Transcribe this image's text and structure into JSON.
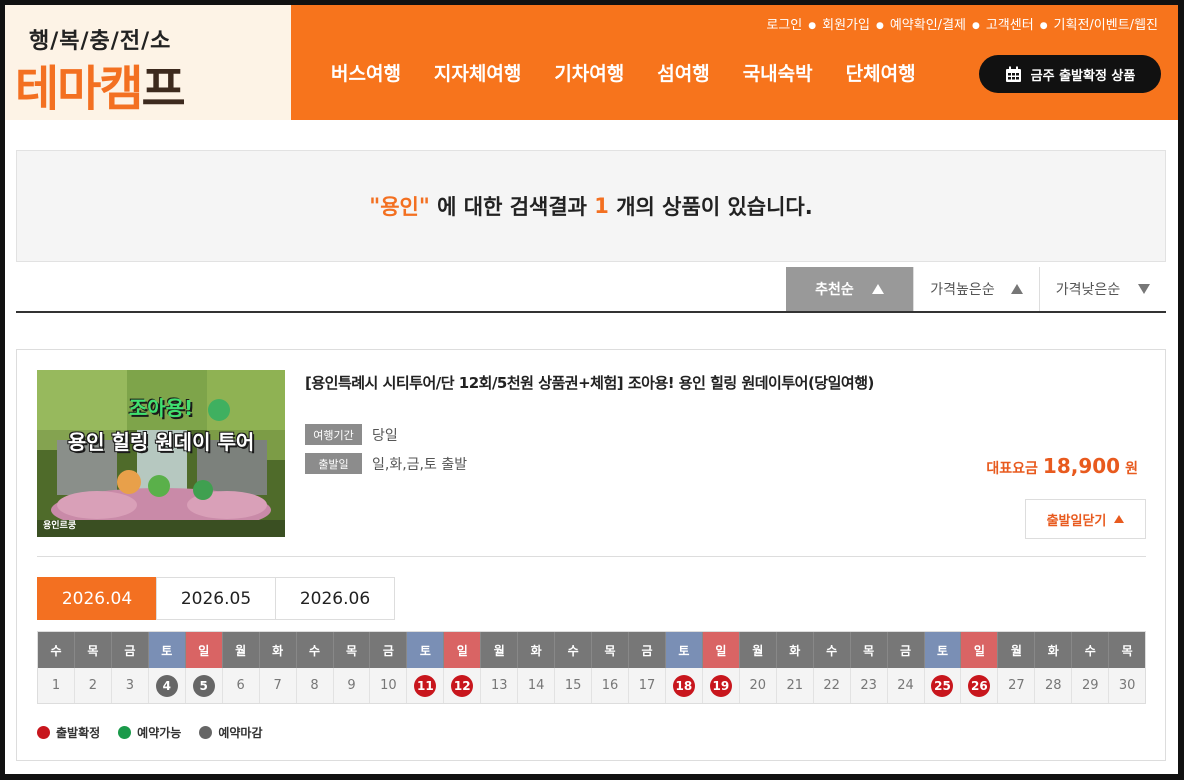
{
  "logo": {
    "sub": "행/복/충/전/소",
    "main_a": "테",
    "main_b": "마",
    "main_c": "캠",
    "main_d": "프"
  },
  "toplinks": [
    "로그인",
    "회원가입",
    "예약확인/결제",
    "고객센터",
    "기획전/이벤트/웹진"
  ],
  "menu": [
    "버스여행",
    "지자체여행",
    "기차여행",
    "섬여행",
    "국내숙박",
    "단체여행"
  ],
  "weekly_button": "금주 출발확정 상품",
  "search": {
    "quote_open": "\"",
    "keyword": "용인",
    "quote_close": "\"",
    "mid": " 에 대한 검색결과 ",
    "count": "1",
    "tail": " 개의 상품이 있습니다."
  },
  "sort": {
    "recommended": "추천순",
    "price_high": "가격높은순",
    "price_low": "가격낮은순"
  },
  "product": {
    "title": "[용인특례시 시티투어/단 12회/5천원 상품권+체험] 조아용! 용인 힐링 원데이투어(당일여행)",
    "thumb_line1": "조아용!",
    "thumb_line2": "용인 힐링 원데이 투어",
    "thumb_mark": "용인르쿵",
    "duration_label": "여행기간",
    "duration_value": "당일",
    "departure_label": "출발일",
    "departure_value": "일,화,금,토 출발",
    "price_label": "대표요금",
    "price_value": "18,900",
    "price_unit": "원",
    "close_button": "출발일닫기"
  },
  "months": [
    "2026.04",
    "2026.05",
    "2026.06"
  ],
  "active_month": "2026.04",
  "calendar": {
    "weekdays": [
      "수",
      "목",
      "금",
      "토",
      "일",
      "월",
      "화",
      "수",
      "목",
      "금",
      "토",
      "일",
      "월",
      "화",
      "수",
      "목",
      "금",
      "토",
      "일",
      "월",
      "화",
      "수",
      "목",
      "금",
      "토",
      "일",
      "월",
      "화",
      "수",
      "목"
    ],
    "days": [
      "1",
      "2",
      "3",
      "4",
      "5",
      "6",
      "7",
      "8",
      "9",
      "10",
      "11",
      "12",
      "13",
      "14",
      "15",
      "16",
      "17",
      "18",
      "19",
      "20",
      "21",
      "22",
      "23",
      "24",
      "25",
      "26",
      "27",
      "28",
      "29",
      "30"
    ],
    "closed": [
      4,
      5
    ],
    "confirmed": [
      11,
      12,
      18,
      19,
      25,
      26
    ]
  },
  "legend": [
    {
      "label": "출발확정",
      "color": "#c8161d"
    },
    {
      "label": "예약가능",
      "color": "#1a9a4a"
    },
    {
      "label": "예약마감",
      "color": "#666666"
    }
  ],
  "colors": {
    "brand": "#f7741c",
    "accent": "#f37021",
    "price": "#e85a1e"
  }
}
